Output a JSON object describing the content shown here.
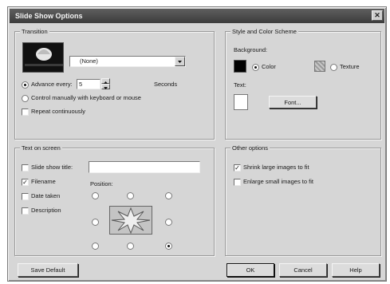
{
  "title": "Slide Show Options",
  "close_glyph": "✕",
  "transition": {
    "legend": "Transition",
    "effect_value": "(None)",
    "advance_label": "Advance every:",
    "advance_value": "5",
    "seconds_label": "Seconds",
    "manual_label": "Control manually with keyboard or mouse",
    "repeat_label": "Repeat continuously"
  },
  "style": {
    "legend": "Style and Color Scheme",
    "background_label": "Background:",
    "color_label": "Color",
    "texture_label": "Texture",
    "text_label": "Text:",
    "font_button": "Font..."
  },
  "text_on_screen": {
    "legend": "Text on screen",
    "slide_show_title_label": "Slide show title:",
    "slide_show_title_value": "",
    "filename_label": "Filename",
    "date_taken_label": "Date taken",
    "description_label": "Description",
    "position_label": "Position:"
  },
  "other_options": {
    "legend": "Other options",
    "shrink_label": "Shrink large images to fit",
    "enlarge_label": "Enlarge small images to fit"
  },
  "buttons": {
    "save_default": "Save Default",
    "ok": "OK",
    "cancel": "Cancel",
    "help": "Help"
  },
  "state": {
    "advance_every_checked": true,
    "manual_checked": false,
    "repeat_checked": false,
    "background_color_selected": true,
    "slide_show_title_checked": false,
    "filename_checked": true,
    "date_taken_checked": false,
    "description_checked": false,
    "shrink_checked": true,
    "enlarge_checked": false,
    "position_selected": "bottom-right"
  },
  "colors": {
    "background_swatch": "#000000",
    "text_swatch": "#ffffff"
  }
}
